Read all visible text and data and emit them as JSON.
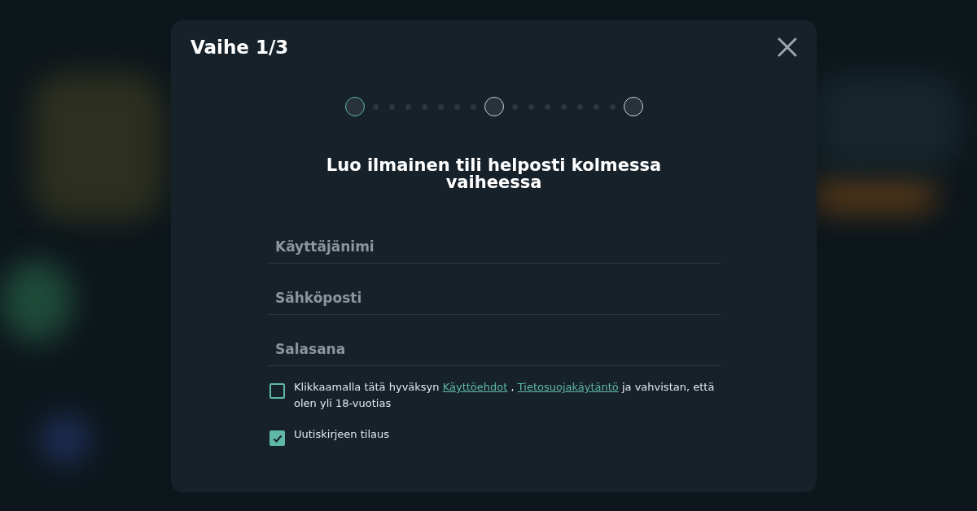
{
  "dialog": {
    "title": "Vaihe 1/3",
    "steps": [
      {
        "selected": true
      },
      {
        "selected": false
      },
      {
        "selected": false
      }
    ],
    "heading": "Luo ilmainen tili helposti kolmessa vaiheessa",
    "fields": [
      {
        "placeholder": "Käyttäjänimi"
      },
      {
        "placeholder": "Sähköposti"
      },
      {
        "placeholder": "Salasana"
      }
    ],
    "checkboxes": [
      {
        "checked": false,
        "parts": [
          {
            "kind": "text",
            "text": "Klikkaamalla tätä hyväksyn "
          },
          {
            "kind": "link",
            "text": "Käyttöehdot"
          },
          {
            "kind": "text",
            "text": " , "
          },
          {
            "kind": "link",
            "text": "Tietosuojakäytäntö"
          },
          {
            "kind": "text",
            "text": " ja vahvistan, että olen yli 18-vuotias"
          }
        ]
      },
      {
        "checked": true,
        "parts": [
          {
            "kind": "text",
            "text": "Uutiskirjeen tilaus"
          }
        ]
      }
    ]
  }
}
